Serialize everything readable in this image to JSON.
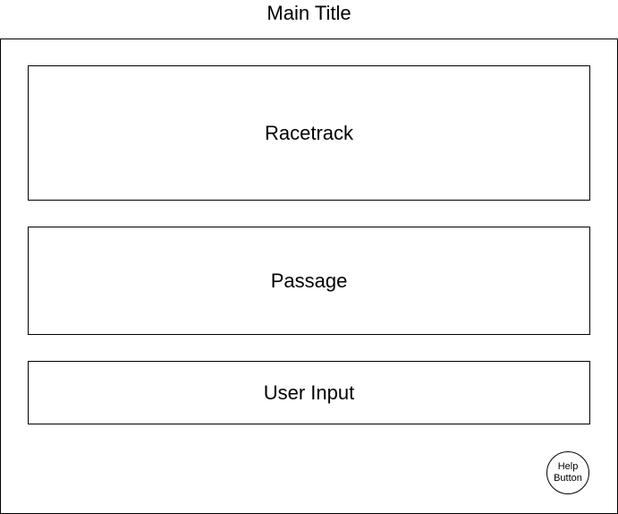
{
  "title": "Main Title",
  "sections": {
    "racetrack": "Racetrack",
    "passage": "Passage",
    "user_input": "User Input"
  },
  "help_button": {
    "line1": "Help",
    "line2": "Button"
  }
}
